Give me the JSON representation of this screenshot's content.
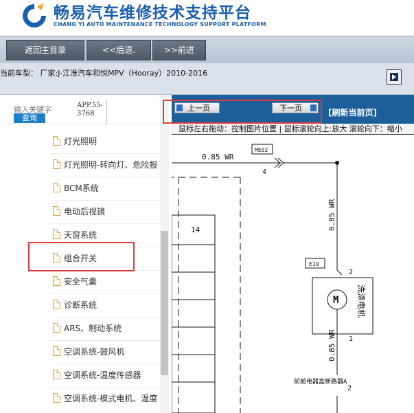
{
  "header": {
    "title": "畅易汽车维修技术支持平台",
    "subtitle": "CHANG YI AUTO MAINTENANCE TECHNOLOGY SUPPORT PLATFORM",
    "brand_color": "#1b5fb0",
    "logo_icon": "chang-yi-logo"
  },
  "nav": {
    "home": "返回主目录",
    "back": "<<后退.",
    "forward": ">>前进"
  },
  "car_info": "当前车型：  厂家:J-江淮汽车和悦MPV（Hooray）2010-2016",
  "search": {
    "label": "输入关键字",
    "button": "查询",
    "value": "APP.55-3768",
    "icon": "search-icon"
  },
  "tree": {
    "items": [
      {
        "label": "灯光照明"
      },
      {
        "label": "灯光照明-转向灯、危险报"
      },
      {
        "label": "BCM系统"
      },
      {
        "label": "电动后视镜"
      },
      {
        "label": "天窗系统"
      },
      {
        "label": "组合开关"
      },
      {
        "label": "安全气囊"
      },
      {
        "label": "诊断系统"
      },
      {
        "label": "ARS、制动系统"
      },
      {
        "label": "空调系统-鼓风机"
      },
      {
        "label": "空调系统-温度传感器"
      },
      {
        "label": "空调系统-模式电机、温度"
      }
    ],
    "highlighted_index": 5
  },
  "viewer": {
    "prev": "上一页",
    "next": "下一页",
    "refresh": "[刷新当前页]",
    "hint": "鼠标左右拖动：控制图片位置 | 鼠标滚轮向上:放大  滚轮向下：缩小"
  },
  "diagram": {
    "wire_top": "0.85 WR",
    "pin_top": "4",
    "connector_me02": "ME02",
    "wire_vertical": "0.85 WR",
    "connector_e19": "E19",
    "pin_2": "2",
    "motor_label": "M",
    "washer_motor": "洗涤电机",
    "pin_1": "1",
    "wire_lower": "0.85 WR",
    "box_number": "14",
    "relay_label": "前舱电器盒断路器A",
    "pin_bottom": "2"
  },
  "colors": {
    "highlight_red": "#e03a3a",
    "viewer_bar": "#1d5f9a",
    "query_blue": "#1e7fc9"
  }
}
